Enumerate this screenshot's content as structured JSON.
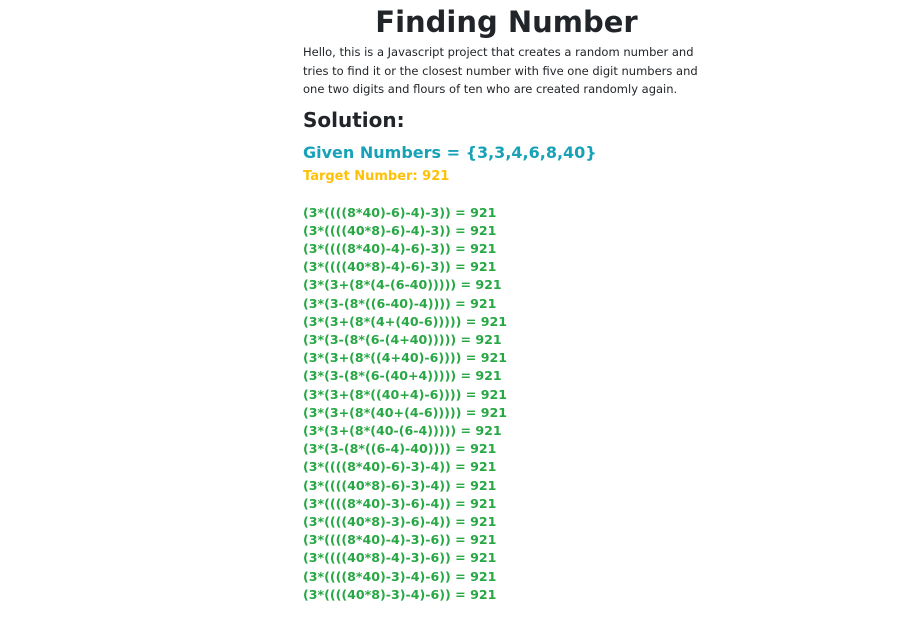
{
  "header": {
    "title": "Finding Number"
  },
  "intro": {
    "text": "Hello, this is a Javascript project that creates a random number and tries to find it or the closest number with five one digit numbers and one two digits and flours of ten who are created randomly again."
  },
  "solution": {
    "heading": "Solution:",
    "given_numbers": "Given Numbers = {3,3,4,6,8,40}",
    "target_number": "Target Number: 921",
    "results": [
      "(3*((((8*40)-6)-4)-3)) = 921",
      "(3*((((40*8)-6)-4)-3)) = 921",
      "(3*((((8*40)-4)-6)-3)) = 921",
      "(3*((((40*8)-4)-6)-3)) = 921",
      "(3*(3+(8*(4-(6-40))))) = 921",
      "(3*(3-(8*((6-40)-4)))) = 921",
      "(3*(3+(8*(4+(40-6))))) = 921",
      "(3*(3-(8*(6-(4+40))))) = 921",
      "(3*(3+(8*((4+40)-6)))) = 921",
      "(3*(3-(8*(6-(40+4))))) = 921",
      "(3*(3+(8*((40+4)-6)))) = 921",
      "(3*(3+(8*(40+(4-6))))) = 921",
      "(3*(3+(8*(40-(6-4))))) = 921",
      "(3*(3-(8*((6-4)-40)))) = 921",
      "(3*((((8*40)-6)-3)-4)) = 921",
      "(3*((((40*8)-6)-3)-4)) = 921",
      "(3*((((8*40)-3)-6)-4)) = 921",
      "(3*((((40*8)-3)-6)-4)) = 921",
      "(3*((((8*40)-4)-3)-6)) = 921",
      "(3*((((40*8)-4)-3)-6)) = 921",
      "(3*((((8*40)-3)-4)-6)) = 921",
      "(3*((((40*8)-3)-4)-6)) = 921"
    ]
  },
  "colors": {
    "given_numbers": "#17a2b8",
    "target_number": "#ffc107",
    "results": "#28a745",
    "text": "#212529"
  }
}
